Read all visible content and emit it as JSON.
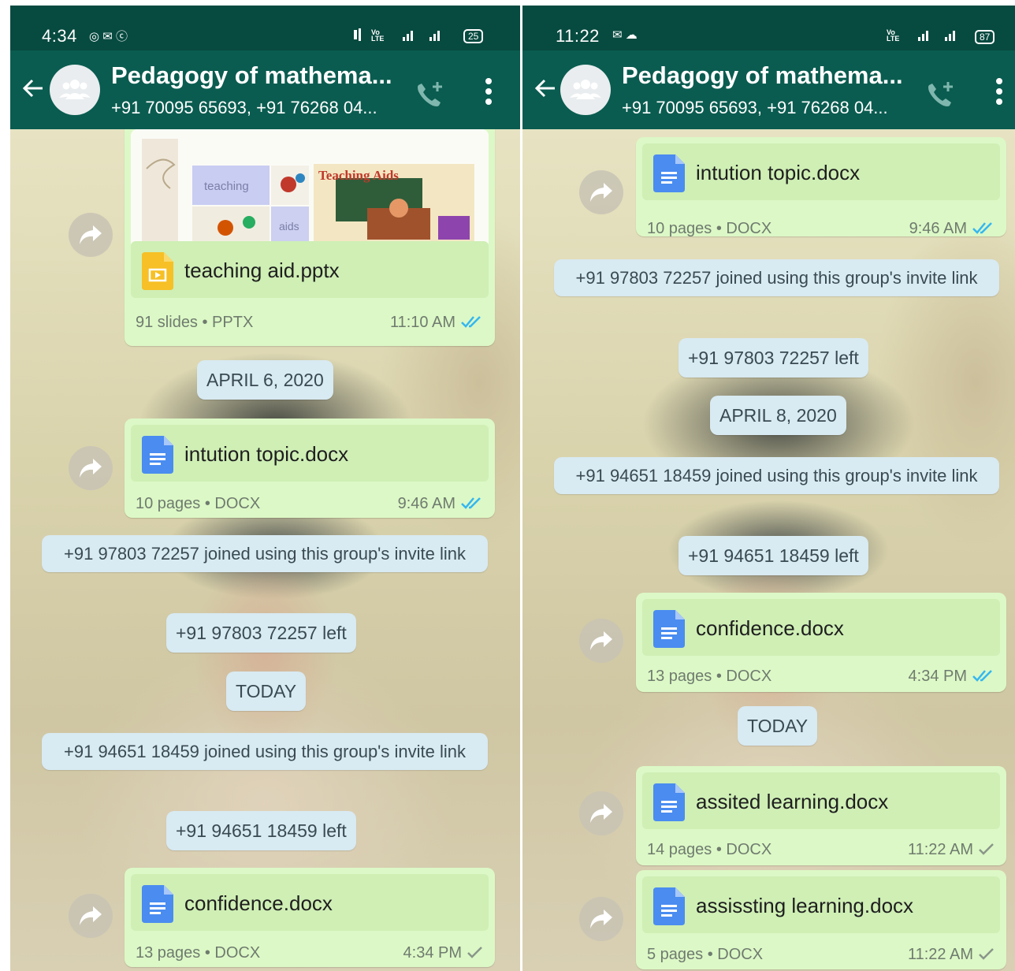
{
  "left": {
    "status": {
      "time": "4:34",
      "icons_left": "◎ ✉ ⓒ",
      "battery": "25"
    },
    "header": {
      "title": "Pedagogy of mathema...",
      "subtitle": "+91 70095 65693, +91 76268 04..."
    },
    "thumbnail": {
      "left_caption_1": "teaching",
      "left_caption_2": "aids",
      "right_caption": "Teaching Aids"
    },
    "messages": {
      "m1": {
        "name": "teaching aid.pptx",
        "meta": "91 slides • PPTX",
        "time": "11:10 AM"
      },
      "d1": "APRIL 6, 2020",
      "m2": {
        "name": "intution topic.docx",
        "meta": "10 pages • DOCX",
        "time": "9:46 AM"
      },
      "s1": "+91 97803 72257 joined using this group's invite link",
      "s2": "+91 97803 72257 left",
      "d2": "TODAY",
      "s3": "+91 94651 18459 joined using this group's invite link",
      "s4": "+91 94651 18459 left",
      "m3": {
        "name": "confidence.docx",
        "meta": "13 pages • DOCX",
        "time": "4:34 PM"
      }
    }
  },
  "right": {
    "status": {
      "time": "11:22",
      "icons_left": "✉ ☁",
      "battery": "87"
    },
    "header": {
      "title": "Pedagogy of mathema...",
      "subtitle": "+91 70095 65693, +91 76268 04..."
    },
    "messages": {
      "m1": {
        "name": "intution topic.docx",
        "meta": "10 pages • DOCX",
        "time": "9:46 AM"
      },
      "s1": "+91 97803 72257 joined using this group's invite link",
      "s2": "+91 97803 72257 left",
      "d1": "APRIL 8, 2020",
      "s3": "+91 94651 18459 joined using this group's invite link",
      "s4": "+91 94651 18459 left",
      "m2": {
        "name": "confidence.docx",
        "meta": "13 pages • DOCX",
        "time": "4:34 PM"
      },
      "d2": "TODAY",
      "m3": {
        "name": "assited learning.docx",
        "meta": "14 pages • DOCX",
        "time": "11:22 AM"
      },
      "m4": {
        "name": "assissting learning.docx",
        "meta": "5 pages • DOCX",
        "time": "11:22 AM"
      }
    }
  },
  "colors": {
    "header": "#0a5c50",
    "statusbar": "#074a40",
    "bubble": "#dcf8c6",
    "system": "#d8eaf2",
    "read_tick": "#34b7f1"
  },
  "icons": {
    "back": "arrow-left-icon",
    "call": "add-call-icon",
    "menu": "more-vert-icon",
    "forward": "forward-icon",
    "docx": "docx-file-icon",
    "pptx": "pptx-file-icon"
  }
}
